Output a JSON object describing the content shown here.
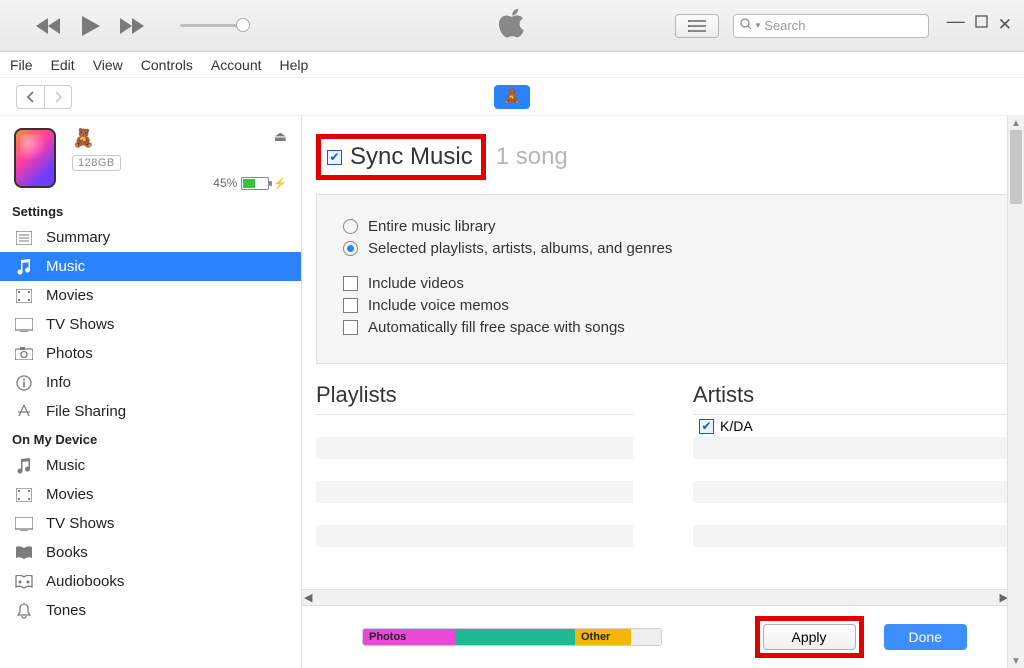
{
  "search": {
    "placeholder": "Search"
  },
  "menu": [
    "File",
    "Edit",
    "View",
    "Controls",
    "Account",
    "Help"
  ],
  "device": {
    "storage_badge": "128GB",
    "battery_pct": "45%"
  },
  "sidebar": {
    "section_settings": "Settings",
    "section_device": "On My Device",
    "settings": [
      {
        "label": "Summary"
      },
      {
        "label": "Music"
      },
      {
        "label": "Movies"
      },
      {
        "label": "TV Shows"
      },
      {
        "label": "Photos"
      },
      {
        "label": "Info"
      },
      {
        "label": "File Sharing"
      }
    ],
    "device": [
      {
        "label": "Music"
      },
      {
        "label": "Movies"
      },
      {
        "label": "TV Shows"
      },
      {
        "label": "Books"
      },
      {
        "label": "Audiobooks"
      },
      {
        "label": "Tones"
      }
    ]
  },
  "sync": {
    "title": "Sync Music",
    "count": "1 song",
    "radio_entire": "Entire music library",
    "radio_selected": "Selected playlists, artists, albums, and genres",
    "chk_videos": "Include videos",
    "chk_memos": "Include voice memos",
    "chk_autofill": "Automatically fill free space with songs"
  },
  "columns": {
    "playlists_title": "Playlists",
    "artists_title": "Artists",
    "artists": [
      {
        "label": "K/DA",
        "checked": true
      }
    ]
  },
  "storage": {
    "photos": "Photos",
    "other": "Other"
  },
  "buttons": {
    "apply": "Apply",
    "done": "Done"
  }
}
